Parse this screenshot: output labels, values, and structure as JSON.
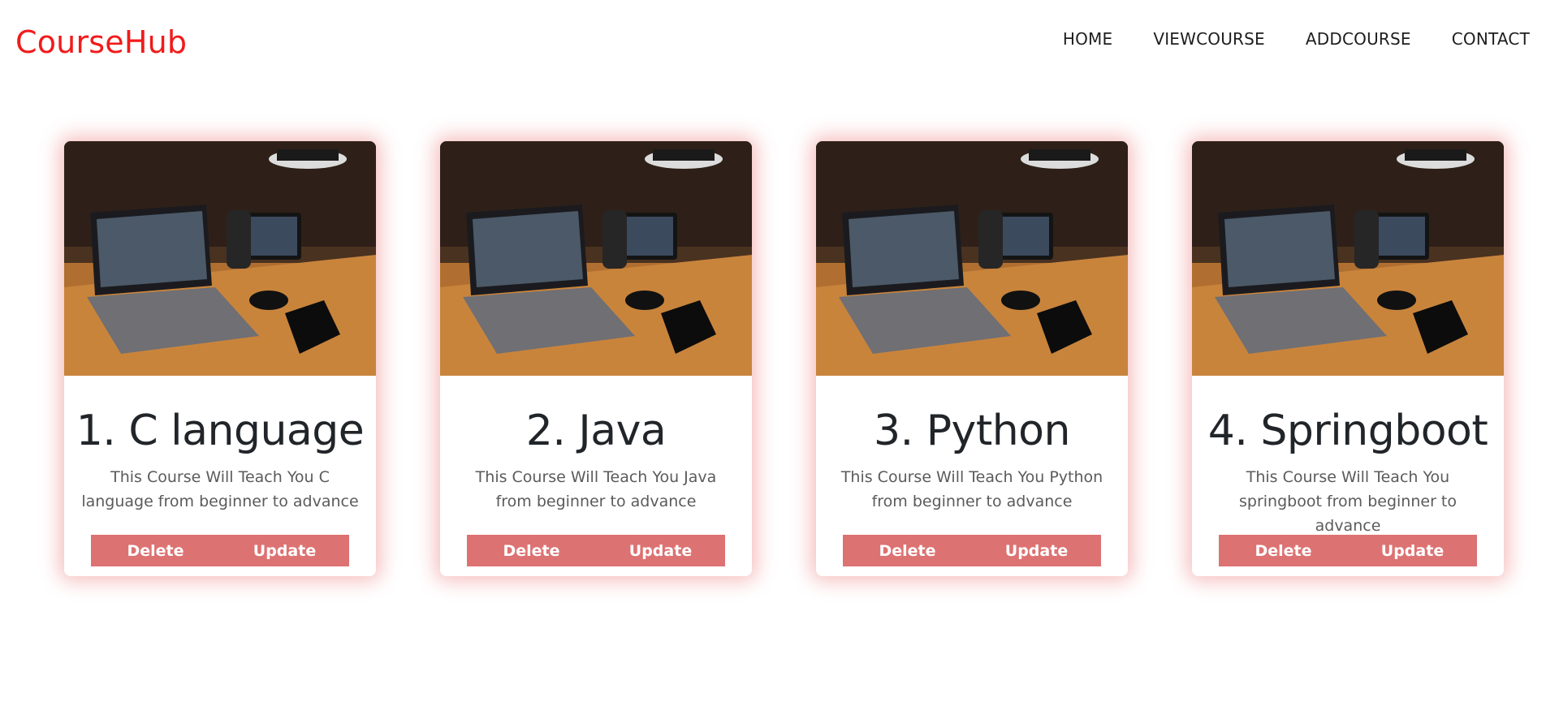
{
  "brand": "CourseHub",
  "nav": {
    "home": "HOME",
    "viewcourse": "VIEWCOURSE",
    "addcourse": "ADDCOURSE",
    "contact": "CONTACT"
  },
  "colors": {
    "brand": "#f11b1b",
    "button": "#dd7272",
    "card_glow": "#ec6e6e"
  },
  "cards": [
    {
      "title": "1. C language",
      "description": "This Course Will Teach You C language from beginner to advance",
      "delete_label": "Delete",
      "update_label": "Update"
    },
    {
      "title": "2. Java",
      "description": "This Course Will Teach You Java from beginner to advance",
      "delete_label": "Delete",
      "update_label": "Update"
    },
    {
      "title": "3. Python",
      "description": "This Course Will Teach You Python from beginner to advance",
      "delete_label": "Delete",
      "update_label": "Update"
    },
    {
      "title": "4. Springboot",
      "description": "This Course Will Teach You springboot from beginner to advance",
      "delete_label": "Delete",
      "update_label": "Update"
    }
  ]
}
